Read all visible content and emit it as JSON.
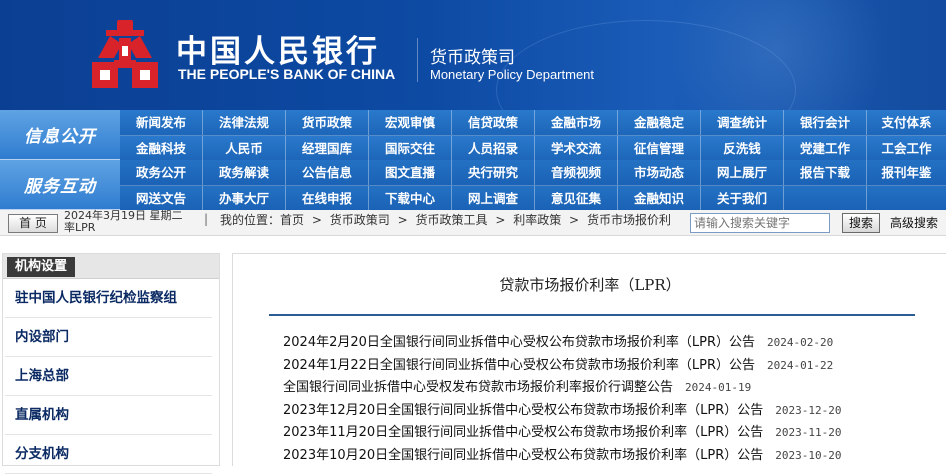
{
  "header": {
    "bank_name_cn": "中国人民银行",
    "bank_name_en": "THE PEOPLE'S BANK OF CHINA",
    "dept_cn": "货币政策司",
    "dept_en": "Monetary Policy Department",
    "logo_color": "#d8232a"
  },
  "nav": {
    "block1": "信息公开",
    "block2": "服务互动",
    "row1": [
      "新闻发布",
      "法律法规",
      "货币政策",
      "宏观审慎",
      "信贷政策",
      "金融市场",
      "金融稳定",
      "调查统计",
      "银行会计",
      "支付体系"
    ],
    "row2": [
      "金融科技",
      "人民币",
      "经理国库",
      "国际交往",
      "人员招录",
      "学术交流",
      "征信管理",
      "反洗钱",
      "党建工作",
      "工会工作"
    ],
    "row3": [
      "政务公开",
      "政务解读",
      "公告信息",
      "图文直播",
      "央行研究",
      "音频视频",
      "市场动态",
      "网上展厅",
      "报告下载",
      "报刊年鉴"
    ],
    "row4": [
      "网送文告",
      "办事大厅",
      "在线申报",
      "下载中心",
      "网上调查",
      "意见征集",
      "金融知识",
      "关于我们",
      "",
      ""
    ]
  },
  "bar": {
    "home_label": "首 页",
    "date_text": "2024年3月19日 星期二",
    "date_overflow": "率LPR",
    "separator": "|",
    "crumbs": [
      "我的位置：首页",
      ">",
      "货币政策司",
      ">",
      "货币政策工具",
      ">",
      "利率政策",
      ">",
      "货币市场报价利"
    ],
    "search_placeholder": "请输入搜索关键字",
    "search_button": "搜索",
    "advanced_search": "高级搜索"
  },
  "sidebar": {
    "title": "机构设置",
    "items": [
      "驻中国人民银行纪检监察组",
      "内设部门",
      "上海总部",
      "直属机构",
      "分支机构"
    ]
  },
  "main": {
    "title": "贷款市场报价利率（LPR）",
    "items": [
      {
        "title": "2024年2月20日全国银行间同业拆借中心受权公布贷款市场报价利率（LPR）公告",
        "date": "2024-02-20"
      },
      {
        "title": "2024年1月22日全国银行间同业拆借中心受权公布贷款市场报价利率（LPR）公告",
        "date": "2024-01-22"
      },
      {
        "title": "全国银行间同业拆借中心受权发布贷款市场报价利率报价行调整公告",
        "date": "2024-01-19"
      },
      {
        "title": "2023年12月20日全国银行间同业拆借中心受权公布贷款市场报价利率（LPR）公告",
        "date": "2023-12-20"
      },
      {
        "title": "2023年11月20日全国银行间同业拆借中心受权公布贷款市场报价利率（LPR）公告",
        "date": "2023-11-20"
      },
      {
        "title": "2023年10月20日全国银行间同业拆借中心受权公布贷款市场报价利率（LPR）公告",
        "date": "2023-10-20"
      }
    ]
  }
}
